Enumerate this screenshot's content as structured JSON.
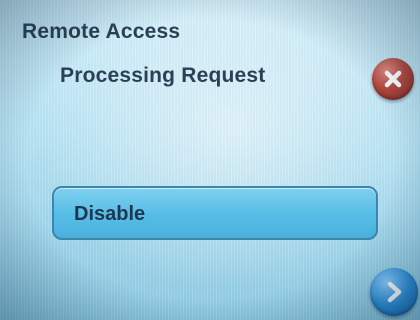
{
  "header": {
    "title": "Remote Access",
    "subtitle": "Processing Request"
  },
  "buttons": {
    "close_icon": "close-x-icon",
    "disable_label": "Disable",
    "next_icon": "chevron-right-icon"
  },
  "colors": {
    "background": "#b4e2f3",
    "text": "#2b3f55",
    "close_button": "#b5473d",
    "disable_button": "#55bde6",
    "next_button": "#2f8fd8"
  }
}
